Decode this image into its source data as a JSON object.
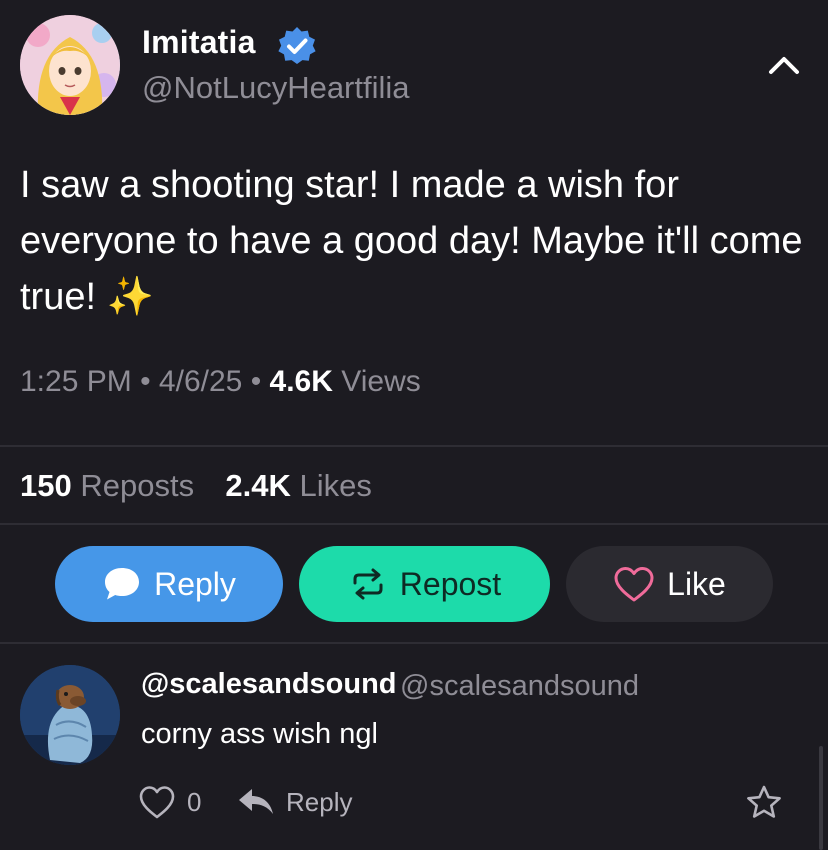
{
  "post": {
    "display_name": "Imitatia",
    "handle": "@NotLucyHeartfilia",
    "text": "I saw a shooting star! I made a wish for everyone to have a good day! Maybe it'll come true! ✨",
    "time": "1:25 PM",
    "date": "4/6/25",
    "views_count": "4.6K",
    "views_label": "Views",
    "reposts_count": "150",
    "reposts_label": "Reposts",
    "likes_count": "2.4K",
    "likes_label": "Likes"
  },
  "actions": {
    "reply_label": "Reply",
    "repost_label": "Repost",
    "like_label": "Like"
  },
  "reply": {
    "username": "@scalesandsound",
    "handle": "@scalesandsound",
    "text": "corny ass wish ngl",
    "like_count": "0",
    "reply_label": "Reply"
  },
  "colors": {
    "background": "#1c1b21",
    "reply_button": "#4697e8",
    "repost_button": "#1ddbaa",
    "like_button": "#2b2a30",
    "like_heart": "#f06b9a",
    "verified": "#4a90e8",
    "muted_text": "#8f8d96"
  },
  "icons": {
    "verified": "verified-badge-icon",
    "collapse": "chevron-up-icon",
    "reply": "speech-bubble-icon",
    "repost": "repost-arrows-icon",
    "like": "heart-icon",
    "reply_arrow": "reply-arrow-icon",
    "bookmark": "star-icon"
  }
}
